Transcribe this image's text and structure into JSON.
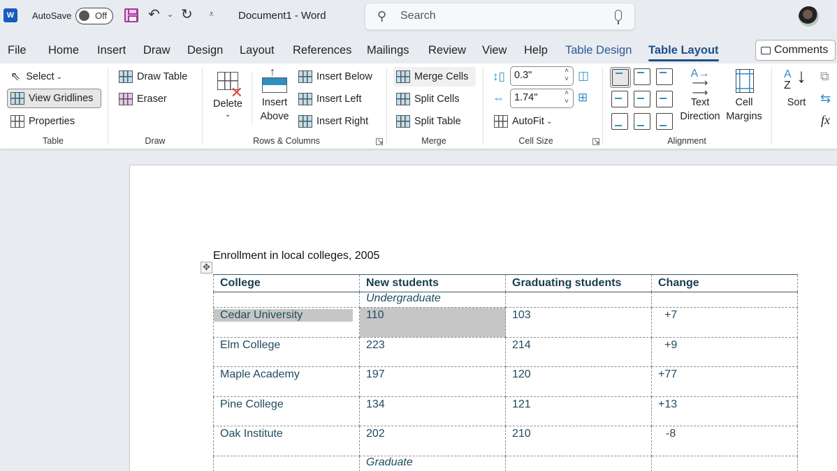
{
  "titlebar": {
    "app_letter": "W",
    "autosave_label": "AutoSave",
    "autosave_state": "Off",
    "doc_title": "Document1  -  Word",
    "search_placeholder": "Search",
    "icons": [
      "word-app-icon",
      "save-icon",
      "undo-icon",
      "redo-icon",
      "customize-qat-icon",
      "search-icon",
      "microphone-icon",
      "avatar"
    ]
  },
  "tabs": [
    {
      "label": "File"
    },
    {
      "label": "Home"
    },
    {
      "label": "Insert"
    },
    {
      "label": "Draw"
    },
    {
      "label": "Design"
    },
    {
      "label": "Layout"
    },
    {
      "label": "References"
    },
    {
      "label": "Mailings"
    },
    {
      "label": "Review"
    },
    {
      "label": "View"
    },
    {
      "label": "Help"
    },
    {
      "label": "Table Design",
      "contextual": true
    },
    {
      "label": "Table Layout",
      "contextual": true,
      "active": true
    }
  ],
  "comments_label": "Comments",
  "ribbon": {
    "table": {
      "label": "Table",
      "select": "Select",
      "view_gridlines": "View Gridlines",
      "view_gridlines_pressed": true,
      "properties": "Properties"
    },
    "draw": {
      "label": "Draw",
      "draw_table": "Draw Table",
      "eraser": "Eraser"
    },
    "rows_columns": {
      "label": "Rows & Columns",
      "delete": "Delete",
      "insert_above_1": "Insert",
      "insert_above_2": "Above",
      "insert_below": "Insert Below",
      "insert_left": "Insert Left",
      "insert_right": "Insert Right"
    },
    "merge": {
      "label": "Merge",
      "merge_cells": "Merge Cells",
      "split_cells": "Split Cells",
      "split_table": "Split Table"
    },
    "cell_size": {
      "label": "Cell Size",
      "height_value": "0.3\"",
      "width_value": "1.74\"",
      "autofit": "AutoFit"
    },
    "alignment": {
      "label": "Alignment",
      "selected": "top-left",
      "text_direction_1": "Text",
      "text_direction_2": "Direction",
      "cell_margins_1": "Cell",
      "cell_margins_2": "Margins"
    },
    "data": {
      "sort": "Sort",
      "formula": "fx"
    }
  },
  "document": {
    "caption": "Enrollment in local colleges, 2005",
    "table": {
      "headers": [
        "College",
        "New students",
        "Graduating students",
        "Change"
      ],
      "sections": [
        {
          "label": "Undergraduate",
          "rows": [
            [
              "Cedar University",
              "110",
              "103",
              "+7"
            ],
            [
              "Elm College",
              "223",
              "214",
              "+9"
            ],
            [
              "Maple Academy",
              "197",
              "120",
              "+77"
            ],
            [
              "Pine College",
              "134",
              "121",
              "+13"
            ],
            [
              "Oak Institute",
              "202",
              "210",
              "-8"
            ]
          ]
        },
        {
          "label": "Graduate",
          "rows": []
        }
      ]
    }
  }
}
